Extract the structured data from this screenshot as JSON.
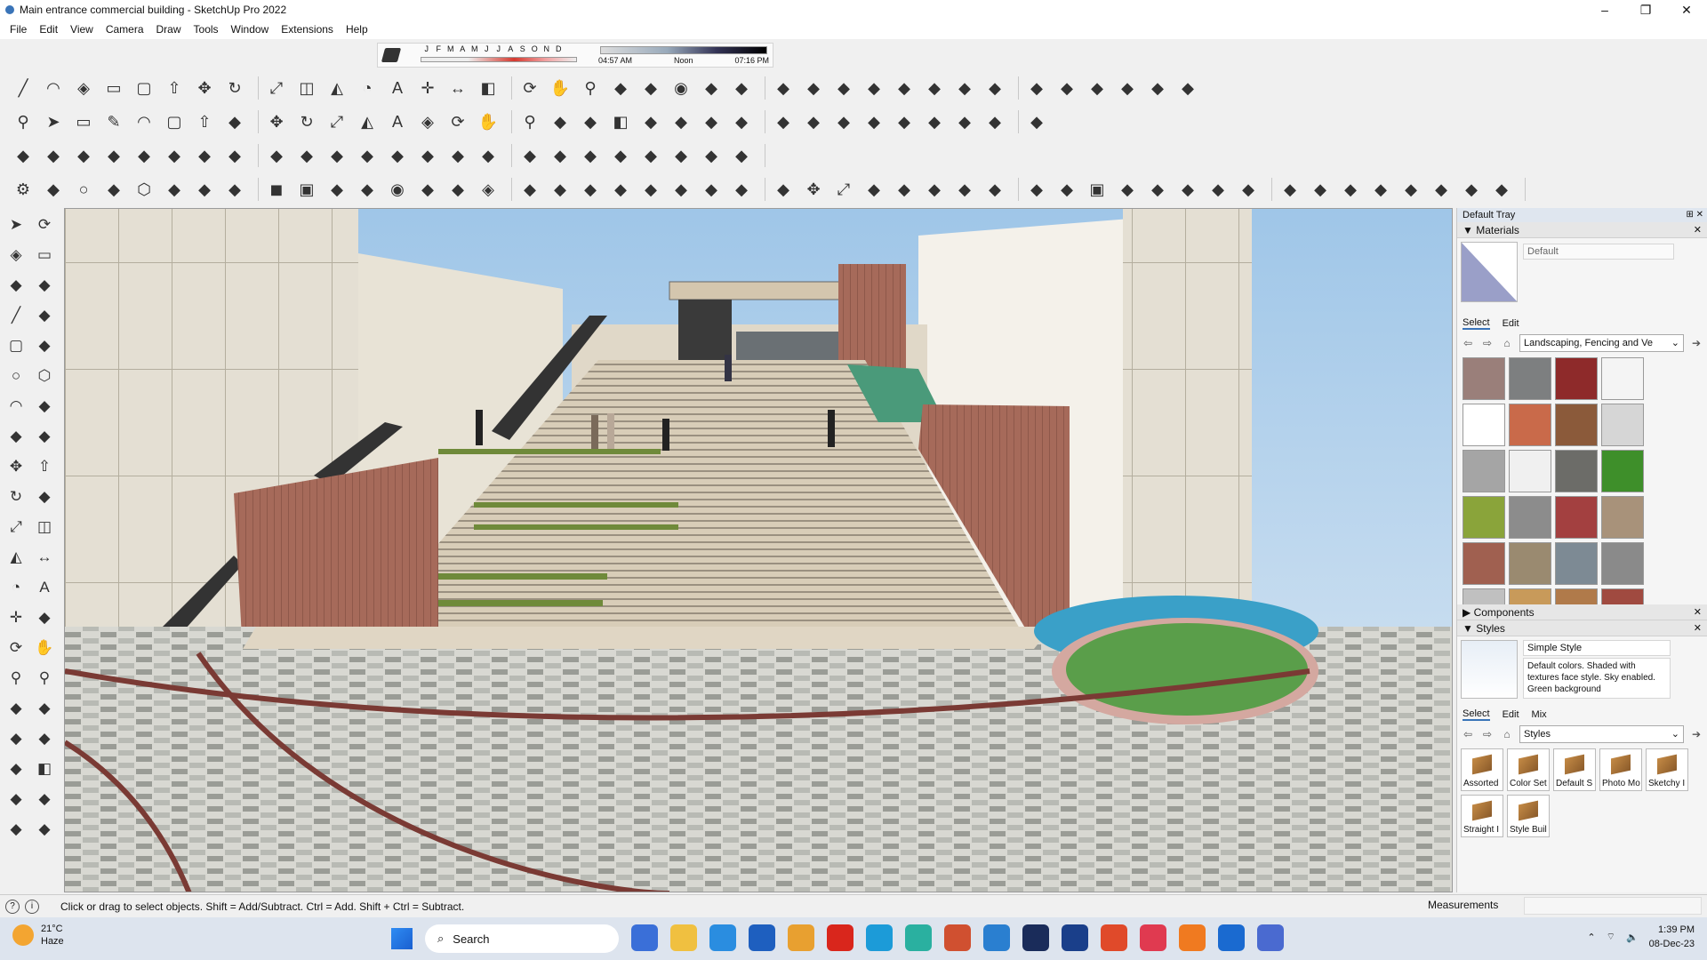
{
  "window": {
    "title": "Main entrance commercial building - SketchUp Pro 2022",
    "controls": [
      "–",
      "❐",
      "✕"
    ]
  },
  "menu": [
    "File",
    "Edit",
    "View",
    "Camera",
    "Draw",
    "Tools",
    "Window",
    "Extensions",
    "Help"
  ],
  "shadow_settings": {
    "months": [
      "J",
      "F",
      "M",
      "A",
      "M",
      "J",
      "J",
      "A",
      "S",
      "O",
      "N",
      "D"
    ],
    "time_start": "04:57 AM",
    "time_mid": "Noon",
    "time_end": "07:16 PM"
  },
  "toolbar_rows": [
    {
      "icons": [
        "line-icon",
        "arc-icon",
        "paint-icon",
        "eraser-icon",
        "rect-icon",
        "push-icon",
        "move-icon",
        "rotate-icon",
        "scale-icon",
        "offset-icon",
        "tape-icon",
        "protractor-icon",
        "text-icon",
        "axes-icon",
        "dimension-icon",
        "section-icon",
        "orbit-icon",
        "pan-icon",
        "zoom-icon",
        "window-icon",
        "extents-icon",
        "camera-icon",
        "walk-icon",
        "look-icon",
        "position-icon",
        "lookaround-icon",
        "sandbox-icon",
        "smoove-icon",
        "stamp-icon",
        "drape-icon",
        "addetail-icon",
        "flip-icon",
        "iso-icon",
        "top-icon",
        "front-icon",
        "right-icon",
        "back-icon",
        "left-icon"
      ]
    },
    {
      "icons": [
        "zoom-icon",
        "select-icon",
        "eraser-icon",
        "pencil-icon",
        "arc-icon",
        "rect-icon",
        "push-icon",
        "followme-icon",
        "move-icon",
        "rotate-icon",
        "scale-icon",
        "tape-icon",
        "text-icon",
        "paint-icon",
        "orbit-icon",
        "pan-icon",
        "zoom-icon",
        "extents-icon",
        "model-info-icon",
        "section-icon",
        "walk-icon",
        "person-icon",
        "geo-icon",
        "warehouse-icon",
        "extension-icon",
        "xray-icon",
        "back-edge-icon",
        "wire-icon",
        "hidden-icon",
        "shaded-icon",
        "textured-icon",
        "mono-icon",
        "share-icon"
      ]
    },
    {
      "icons": [
        "solid-union-icon",
        "solid-subtract-icon",
        "trim-icon",
        "split-icon",
        "outer-shell-icon",
        "intersect-icon",
        "group-icon",
        "component-icon",
        "explode-icon",
        "hide-icon",
        "lock-icon",
        "tag-icon",
        "scenes-icon",
        "layout-icon",
        "styles-icon",
        "shadows-icon",
        "fog-icon",
        "match-photo-icon",
        "soften-icon",
        "materials-icon",
        "outliner-icon",
        "entity-icon",
        "instructor-icon",
        "dynamic-icon"
      ]
    },
    {
      "icons": [
        "settings-icon",
        "spiral-icon",
        "circle-icon",
        "pie-icon",
        "polygon-icon",
        "star-icon",
        "shape-icon",
        "sphere-icon",
        "cube-icon",
        "box-icon",
        "grid-icon",
        "dots-icon",
        "camera-icon",
        "surface-icon",
        "texture-icon",
        "paint-icon",
        "layer-icon",
        "curve-icon",
        "fillet-icon",
        "slice-icon",
        "frame-icon",
        "component-icon",
        "spline-icon",
        "bezier-icon",
        "cross-icon",
        "move-icon",
        "scale-icon",
        "cone-icon",
        "pyramid-icon",
        "warning-icon",
        "lasso-icon",
        "spin-icon",
        "swirl-icon",
        "snap-icon",
        "box-icon",
        "magnet-icon",
        "plant-icon",
        "puzzle-icon",
        "fence-icon",
        "tree-icon",
        "cut-icon",
        "shell-icon",
        "pattern-icon",
        "tile-icon",
        "lattice-icon",
        "weave-icon",
        "curve-icon",
        "more-icon"
      ]
    }
  ],
  "left_tools": [
    [
      "select-icon",
      "orbit-icon"
    ],
    [
      "paint-icon",
      "eraser-icon"
    ],
    [
      "component-icon",
      "tag-icon"
    ],
    [
      "line-icon",
      "freehand-icon"
    ],
    [
      "rect-icon",
      "rotated-rect-icon"
    ],
    [
      "circle-icon",
      "polygon-icon"
    ],
    [
      "arc-icon",
      "arc2-icon"
    ],
    [
      "pie-icon",
      "3pt-arc-icon"
    ],
    [
      "move-icon",
      "push-icon"
    ],
    [
      "rotate-icon",
      "followme-icon"
    ],
    [
      "scale-icon",
      "offset-icon"
    ],
    [
      "tape-icon",
      "dimension-icon"
    ],
    [
      "protractor-icon",
      "text-icon"
    ],
    [
      "axes-icon",
      "3dtext-icon"
    ],
    [
      "orbit-icon",
      "pan-icon"
    ],
    [
      "zoom-icon",
      "zoom-window-icon"
    ],
    [
      "extents-icon",
      "prev-icon"
    ],
    [
      "position-icon",
      "look-icon"
    ],
    [
      "walk-icon",
      "section-icon"
    ],
    [
      "geo-icon",
      "sandbox-icon"
    ],
    [
      "layers-icon",
      "terrain-icon"
    ]
  ],
  "tray": {
    "title": "Default Tray",
    "materials": {
      "header": "Materials",
      "current_name": "Default",
      "tabs": [
        "Select",
        "Edit"
      ],
      "library": "Landscaping, Fencing and Ve",
      "swatch_colors": [
        "#9a7f7a",
        "#7d7f80",
        "#8e2a2a",
        "#f4f4f4",
        "#ffffff",
        "#c96a4a",
        "#8b5a3a",
        "#d6d6d6",
        "#a5a5a5",
        "#f0f0f0",
        "#6c6c68",
        "#3e8f2a",
        "#8aa43a",
        "#8c8c8c",
        "#a34040",
        "#a8927a",
        "#a06050",
        "#9a8a70",
        "#7d8a94",
        "#8a8a8a",
        "#c0c0c0",
        "#c89a5a",
        "#b07a4a",
        "#a04a40"
      ]
    },
    "components": {
      "header": "Components"
    },
    "styles": {
      "header": "Styles",
      "current_name": "Simple Style",
      "description": "Default colors.  Shaded with textures face style.  Sky enabled.  Green background",
      "tabs": [
        "Select",
        "Edit",
        "Mix"
      ],
      "library": "Styles",
      "items": [
        "Assorted",
        "Color Set",
        "Default S",
        "Photo Mo",
        "Sketchy I",
        "Straight I",
        "Style Buil"
      ]
    }
  },
  "status": {
    "message": "Click or drag to select objects. Shift = Add/Subtract. Ctrl = Add. Shift + Ctrl = Subtract.",
    "measurements_label": "Measurements",
    "measurements_value": ""
  },
  "taskbar": {
    "weather_temp": "21°C",
    "weather_desc": "Haze",
    "search": "Search",
    "time": "1:39 PM",
    "date": "08-Dec-23",
    "apps": [
      "#3a6fd8",
      "#f0c040",
      "#2a8de0",
      "#1e5fbf",
      "#e8a030",
      "#d9261c",
      "#1c9bd8",
      "#2ab0a0",
      "#d05030",
      "#2a7fd0",
      "#1a2c5a",
      "#1a3f8a",
      "#e04a2a",
      "#e03a50",
      "#f07a20",
      "#1a6ad0",
      "#4a6ad0"
    ]
  }
}
